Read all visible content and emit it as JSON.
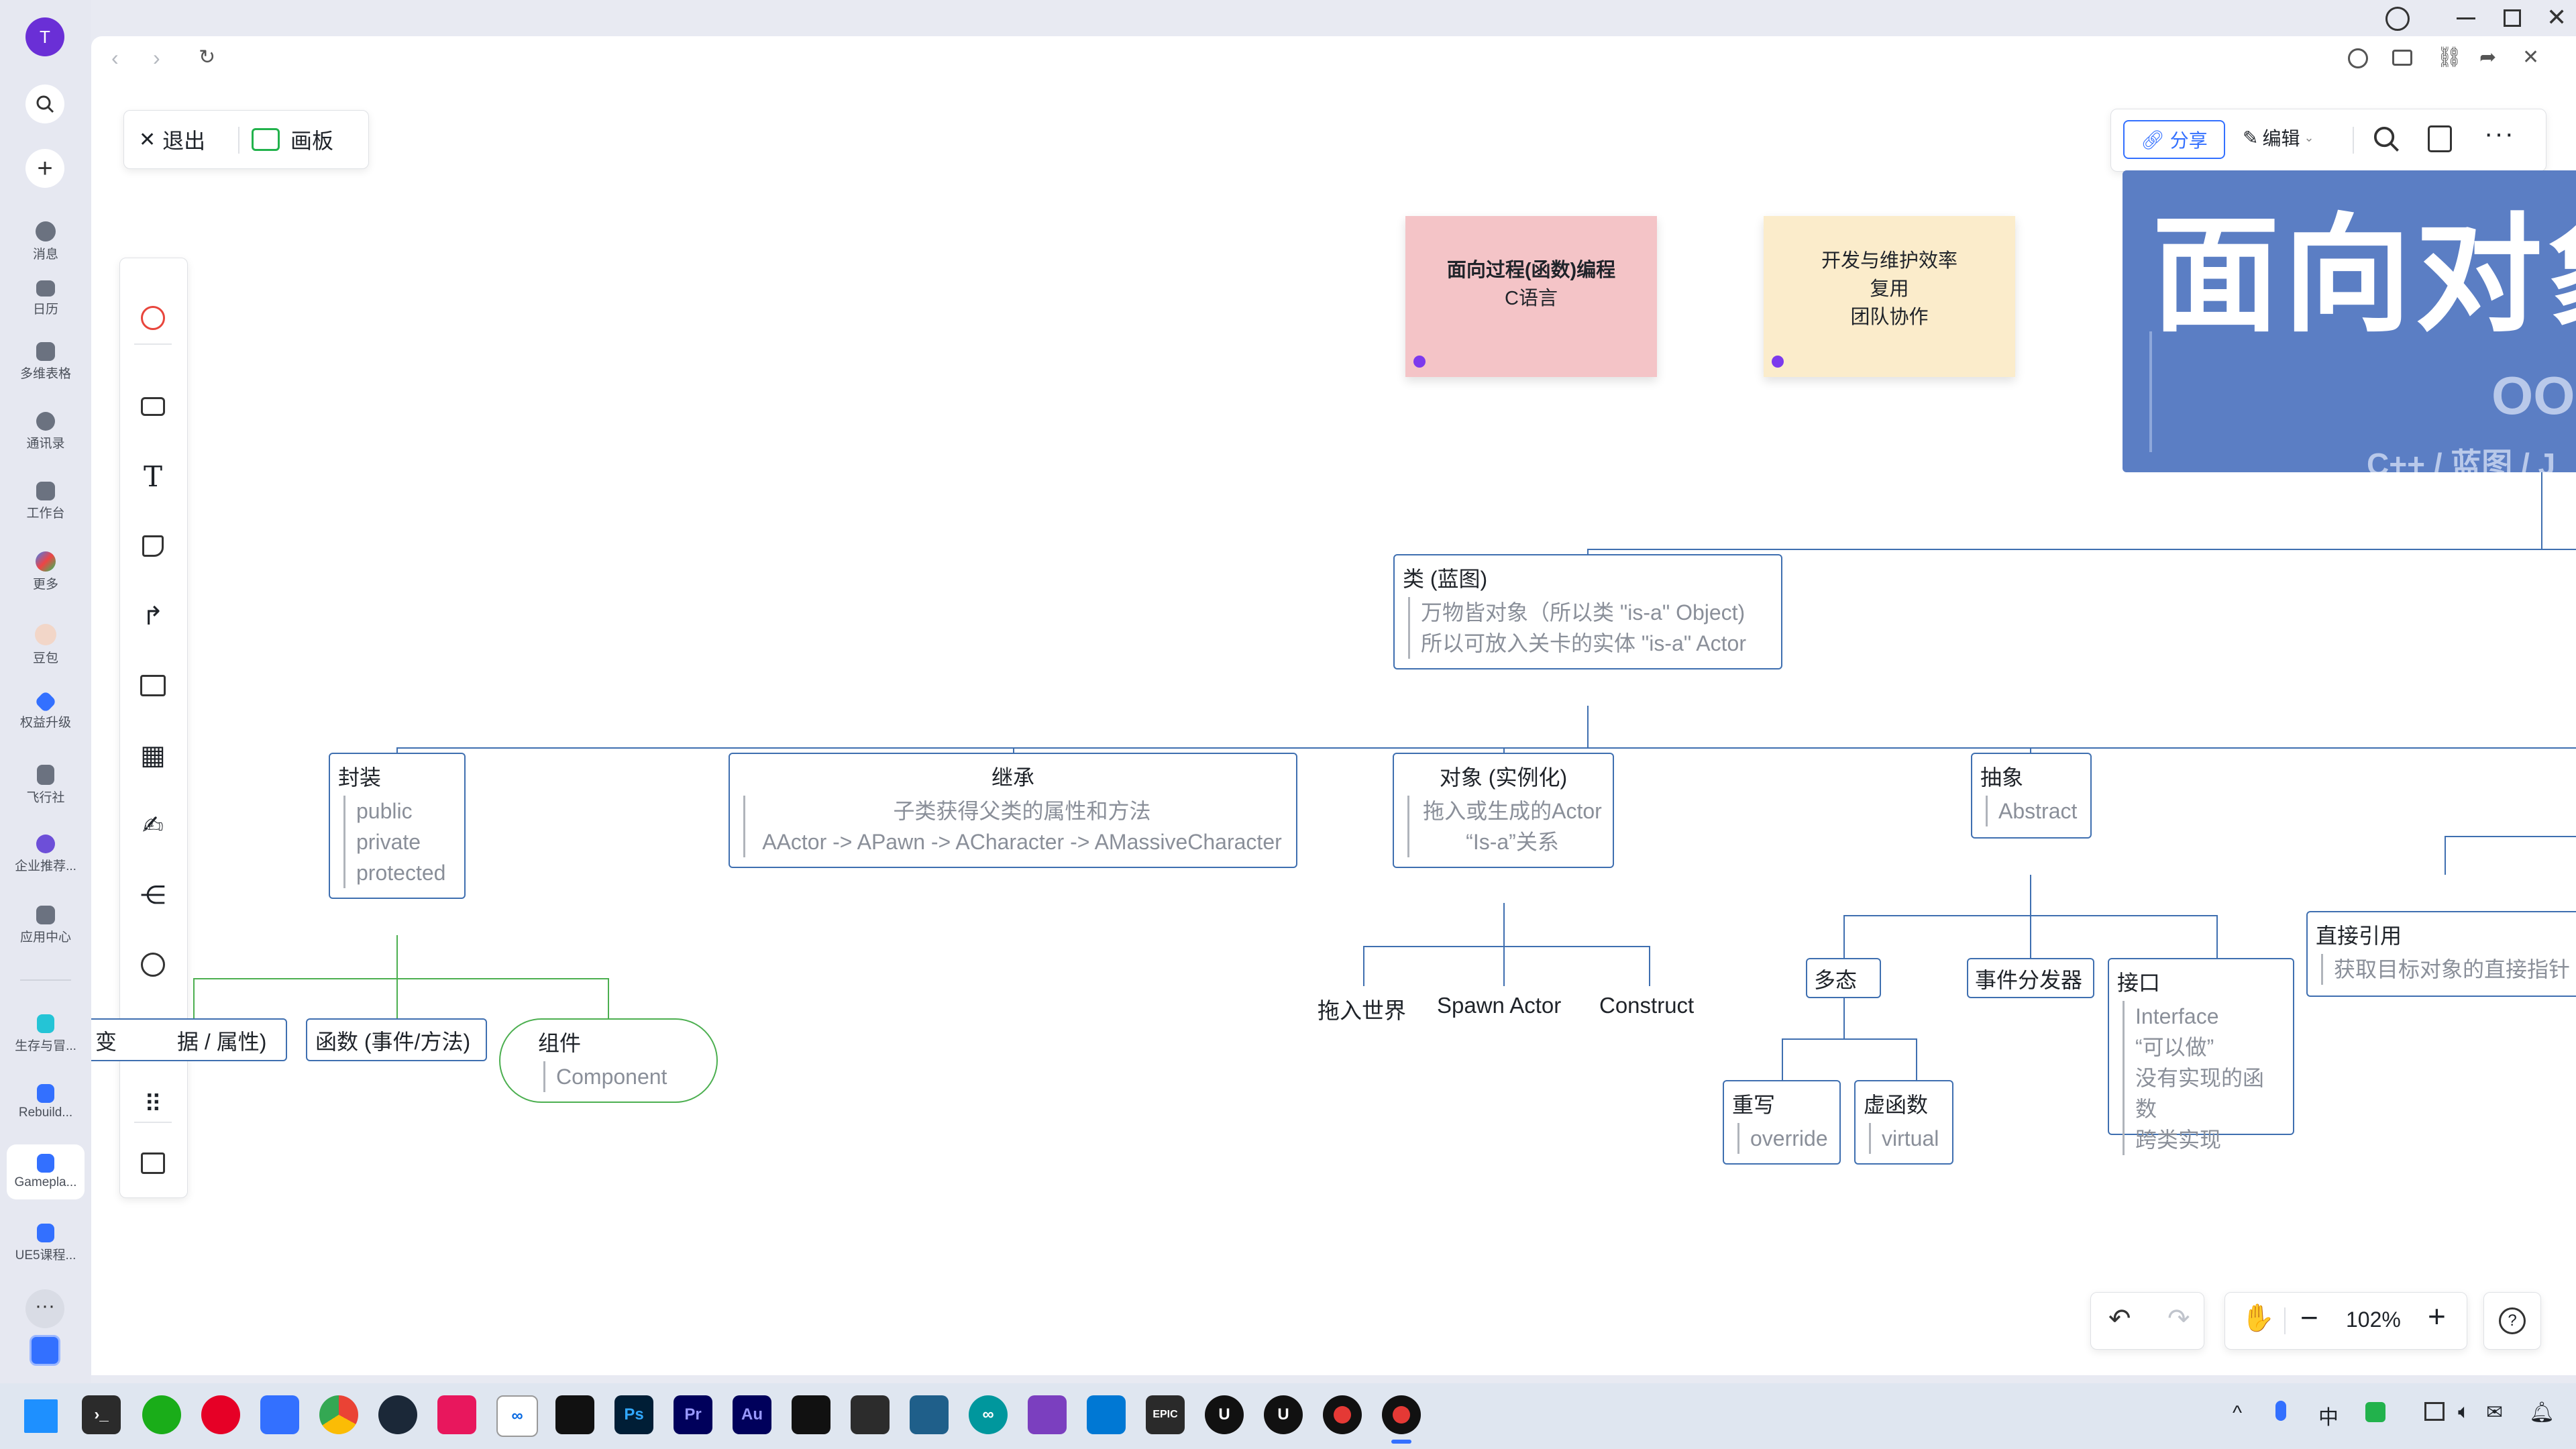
{
  "rail": {
    "avatar_letter": "T",
    "items": [
      {
        "label": "消息"
      },
      {
        "label": "日历"
      },
      {
        "label": "多维表格"
      },
      {
        "label": "通讯录"
      },
      {
        "label": "工作台"
      },
      {
        "label": "更多"
      },
      {
        "label": "豆包"
      },
      {
        "label": "权益升级"
      },
      {
        "label": "飞行社"
      },
      {
        "label": "企业推荐..."
      },
      {
        "label": "应用中心"
      }
    ],
    "docs": [
      {
        "label": "生存与冒..."
      },
      {
        "label": "Rebuild..."
      },
      {
        "label": "Gamepla..."
      },
      {
        "label": "UE5课程..."
      }
    ],
    "more": "···"
  },
  "header": {
    "exit_label": "退出",
    "board_label": "画板",
    "share_label": "分享",
    "edit_label": "编辑"
  },
  "stickies": [
    {
      "line1": "面向过程(函数)编程",
      "line2": "C语言",
      "color": "#f4c4c7"
    },
    {
      "line1": "开发与维护效率",
      "line2": "复用",
      "line3": "团队协作",
      "color": "#fbeccb"
    }
  ],
  "banner": {
    "title": "面向对象",
    "oo": "OO",
    "langs": "C++ / 蓝图 / J",
    "color": "#5b7ec4"
  },
  "mindmap": {
    "class": {
      "title": "类 (蓝图)",
      "l1": "万物皆对象（所以类 \"is-a\" Object)",
      "l2": "所以可放入关卡的实体 \"is-a\" Actor"
    },
    "encap": {
      "title": "封装",
      "l1": "public",
      "l2": "private",
      "l3": "protected"
    },
    "inherit": {
      "title": "继承",
      "l1": "子类获得父类的属性和方法",
      "l2": "AActor -> APawn -> ACharacter -> AMassiveCharacter"
    },
    "object": {
      "title": "对象 (实例化)",
      "l1": "拖入或生成的Actor",
      "l2": "“Is-a”关系"
    },
    "abstract": {
      "title": "抽象",
      "l1": "Abstract"
    },
    "direct": {
      "title": "直接引用",
      "l1": "获取目标对象的直接指针"
    },
    "var": {
      "title": "变",
      "rest": "据 / 属性)"
    },
    "func": {
      "title": "函数 (事件/方法)"
    },
    "comp": {
      "title": "组件",
      "l1": "Component"
    },
    "drag": "拖入世界",
    "spawn": "Spawn Actor",
    "construct": "Construct",
    "poly": "多态",
    "dispatcher": "事件分发器",
    "iface": {
      "title": "接口",
      "l1": "Interface",
      "l2": "“可以做”",
      "l3": "没有实现的函数",
      "l4": "跨类实现"
    },
    "override": {
      "title": "重写",
      "l1": "override"
    },
    "virtual": {
      "title": "虚函数",
      "l1": "virtual"
    }
  },
  "zoom": "102%",
  "taskbar": {
    "apps": [
      "Ps",
      "Pr",
      "Au"
    ],
    "lang": "中",
    "epic": "EPIC"
  }
}
